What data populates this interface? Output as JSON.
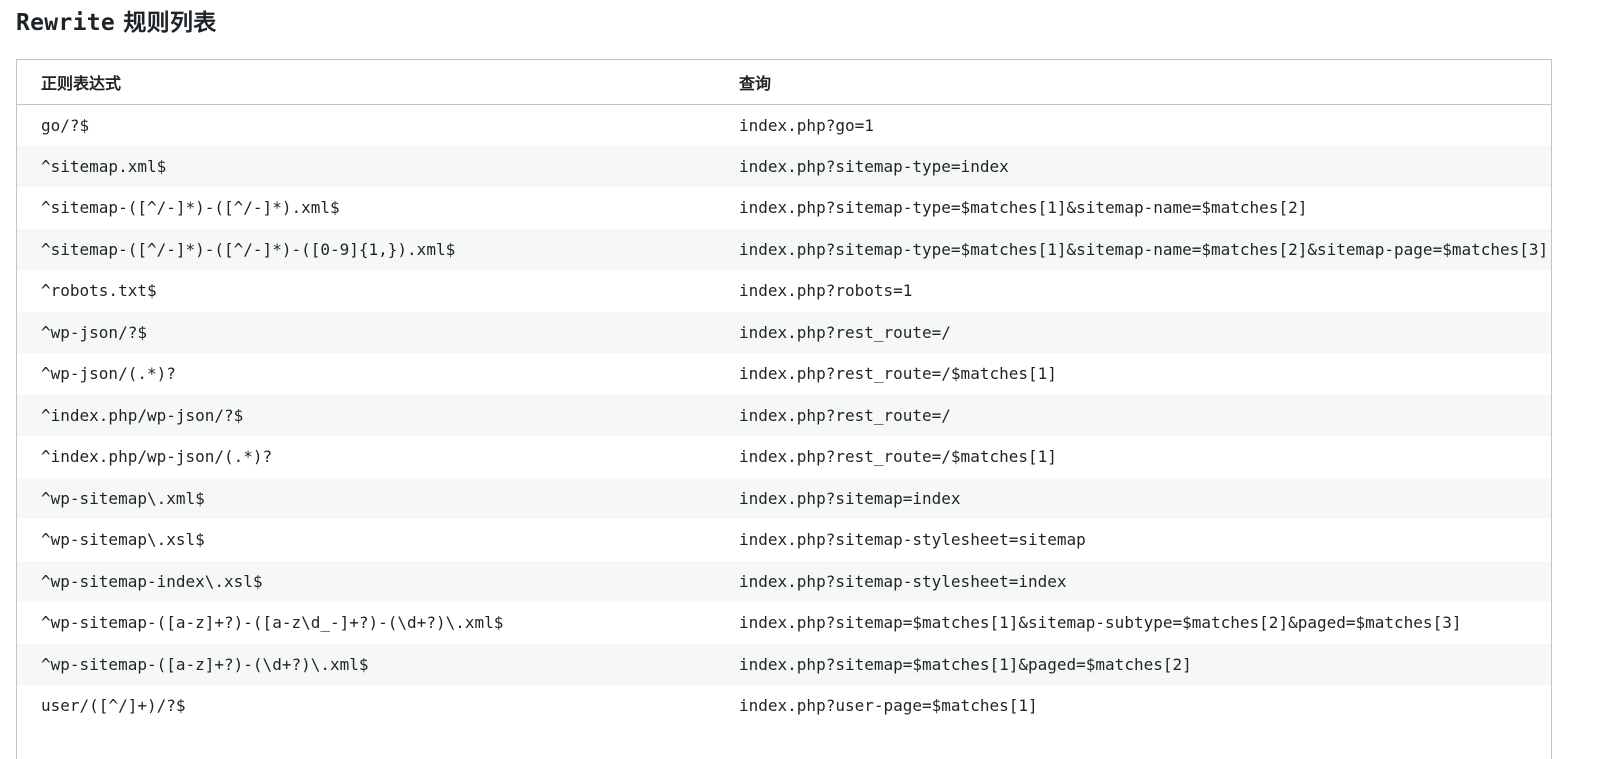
{
  "page": {
    "title_latin": "Rewrite",
    "title_cjk": "规则列表"
  },
  "table": {
    "headers": {
      "regex": "正则表达式",
      "query": "查询"
    },
    "rows": [
      {
        "regex": "go/?$",
        "query": "index.php?go=1"
      },
      {
        "regex": "^sitemap.xml$",
        "query": "index.php?sitemap-type=index"
      },
      {
        "regex": "^sitemap-([^/-]*)-([^/-]*).xml$",
        "query": "index.php?sitemap-type=$matches[1]&sitemap-name=$matches[2]"
      },
      {
        "regex": "^sitemap-([^/-]*)-([^/-]*)-([0-9]{1,}).xml$",
        "query": "index.php?sitemap-type=$matches[1]&sitemap-name=$matches[2]&sitemap-page=$matches[3]"
      },
      {
        "regex": "^robots.txt$",
        "query": "index.php?robots=1"
      },
      {
        "regex": "^wp-json/?$",
        "query": "index.php?rest_route=/"
      },
      {
        "regex": "^wp-json/(.*)?",
        "query": "index.php?rest_route=/$matches[1]"
      },
      {
        "regex": "^index.php/wp-json/?$",
        "query": "index.php?rest_route=/"
      },
      {
        "regex": "^index.php/wp-json/(.*)?",
        "query": "index.php?rest_route=/$matches[1]"
      },
      {
        "regex": "^wp-sitemap\\.xml$",
        "query": "index.php?sitemap=index"
      },
      {
        "regex": "^wp-sitemap\\.xsl$",
        "query": "index.php?sitemap-stylesheet=sitemap"
      },
      {
        "regex": "^wp-sitemap-index\\.xsl$",
        "query": "index.php?sitemap-stylesheet=index"
      },
      {
        "regex": "^wp-sitemap-([a-z]+?)-([a-z\\d_-]+?)-(\\d+?)\\.xml$",
        "query": "index.php?sitemap=$matches[1]&sitemap-subtype=$matches[2]&paged=$matches[3]"
      },
      {
        "regex": "^wp-sitemap-([a-z]+?)-(\\d+?)\\.xml$",
        "query": "index.php?sitemap=$matches[1]&paged=$matches[2]"
      },
      {
        "regex": "user/([^/]+)/?$",
        "query": "index.php?user-page=$matches[1]"
      }
    ]
  }
}
